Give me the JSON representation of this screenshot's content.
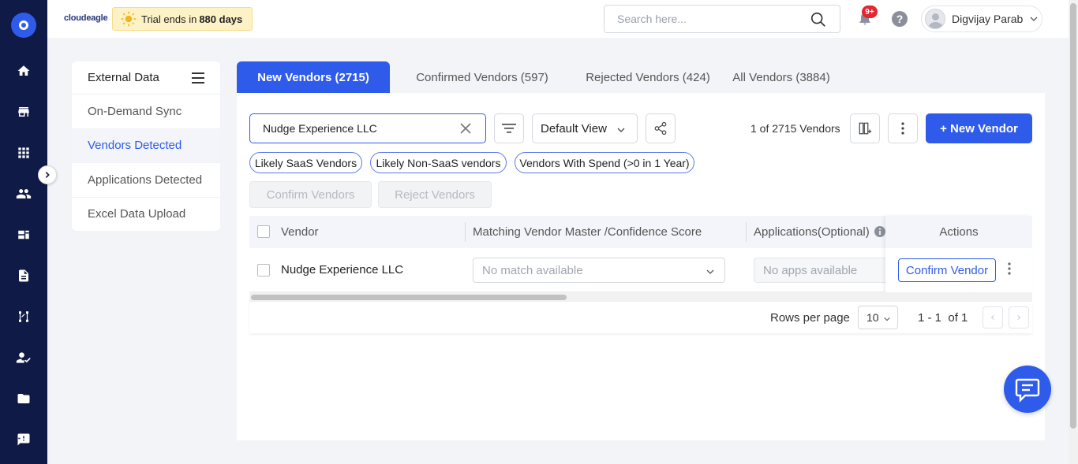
{
  "header": {
    "brand": "cloudeagle",
    "trial_prefix": "Trial ends in",
    "trial_days": "880 days",
    "search_placeholder": "Search here...",
    "notifications_badge": "9+",
    "help": "?",
    "user_name": "Digvijay Parab"
  },
  "nav_icons": [
    "home-icon",
    "store-icon",
    "apps-grid-icon",
    "users-icon",
    "dashboard-icon",
    "document-icon",
    "workflow-icon",
    "user-check-icon",
    "folder-icon",
    "feedback-icon"
  ],
  "sidebar": {
    "title": "External Data",
    "items": [
      {
        "label": "On-Demand Sync",
        "active": false
      },
      {
        "label": "Vendors Detected",
        "active": true
      },
      {
        "label": "Applications Detected",
        "active": false
      },
      {
        "label": "Excel Data Upload",
        "active": false
      }
    ]
  },
  "tabs": [
    {
      "label": "New Vendors (2715)",
      "active": true
    },
    {
      "label": "Confirmed Vendors (597)",
      "active": false
    },
    {
      "label": "Rejected Vendors (424)",
      "active": false
    },
    {
      "label": "All Vendors (3884)",
      "active": false
    }
  ],
  "toolbar": {
    "search_value": "Nudge Experience LLC",
    "view_label": "Default View",
    "count_text": "1 of 2715 Vendors",
    "new_vendor_label": "+ New Vendor"
  },
  "filters": [
    "Likely SaaS Vendors",
    "Likely Non-SaaS vendors",
    "Vendors With Spend (>0 in 1 Year)"
  ],
  "bulk_actions": {
    "confirm": "Confirm Vendors",
    "reject": "Reject Vendors"
  },
  "table": {
    "columns": [
      "Vendor",
      "Matching Vendor Master /Confidence Score",
      "Applications(Optional)",
      "Actions"
    ],
    "rows": [
      {
        "vendor": "Nudge Experience LLC",
        "match": "No match available",
        "apps": "No apps available",
        "action": "Confirm Vendor"
      }
    ]
  },
  "pagination": {
    "rows_per_page_label": "Rows per page",
    "rows_per_page": "10",
    "range": "1 - 1",
    "of": "of 1"
  },
  "colors": {
    "primary": "#2f5bea",
    "nav": "#0f1b46"
  }
}
